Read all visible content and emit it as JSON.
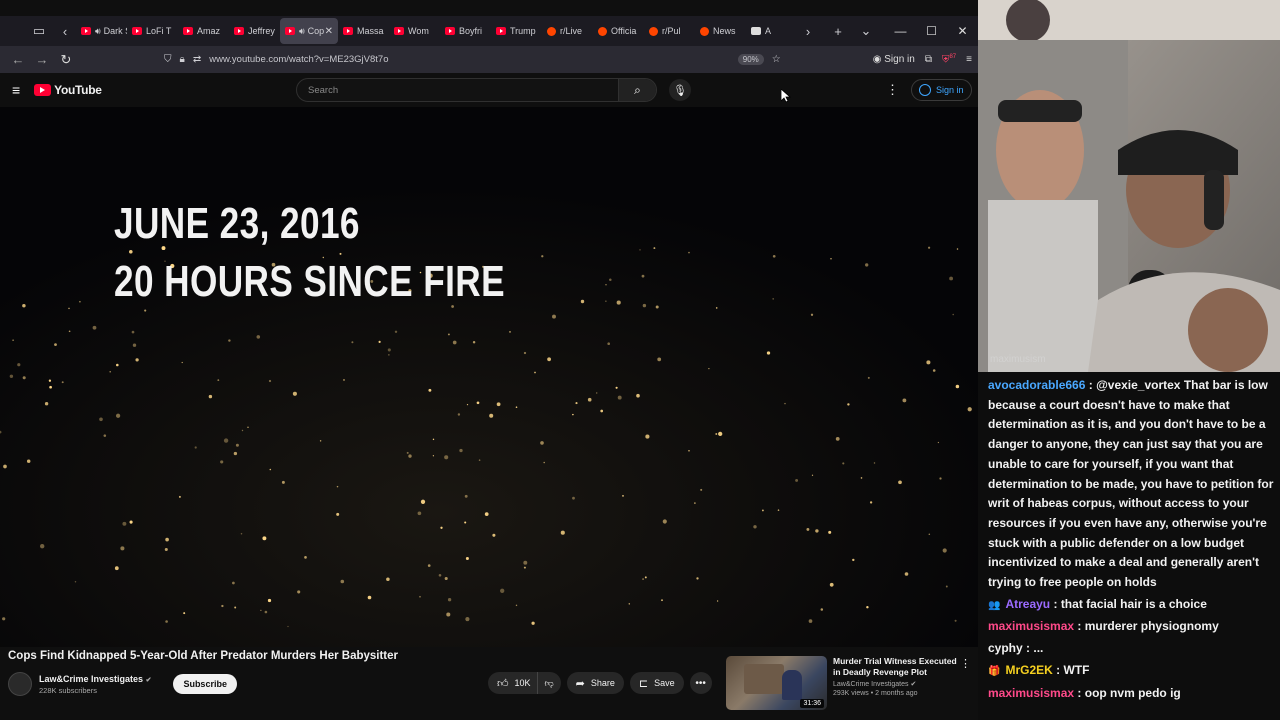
{
  "browser": {
    "tabs": [
      {
        "label": "Dark S",
        "type": "yt",
        "audio": true
      },
      {
        "label": "LoFi T",
        "type": "yt"
      },
      {
        "label": "Amaz",
        "type": "yt"
      },
      {
        "label": "Jeffrey",
        "type": "yt"
      },
      {
        "label": "Cop",
        "type": "yt",
        "audio": true,
        "active": true
      },
      {
        "label": "Massa",
        "type": "yt"
      },
      {
        "label": "Wom",
        "type": "yt"
      },
      {
        "label": "Boyfri",
        "type": "yt"
      },
      {
        "label": "Trump",
        "type": "yt"
      },
      {
        "label": "r/Live",
        "type": "rd"
      },
      {
        "label": "Officia",
        "type": "rd"
      },
      {
        "label": "r/Pul",
        "type": "rd"
      },
      {
        "label": "News",
        "type": "rd"
      },
      {
        "label": "A",
        "type": "md"
      }
    ],
    "url": "www.youtube.com/watch?v=ME23GjV8t7o",
    "zoom": "90%",
    "sign_in": "Sign in",
    "ext_badge": "87"
  },
  "youtube": {
    "logo_text": "YouTube",
    "search_placeholder": "Search",
    "sign_in": "Sign in"
  },
  "video": {
    "overlay_line1": "JUNE 23, 2016",
    "overlay_line2": "20 HOURS SINCE FIRE",
    "title": "Cops Find Kidnapped 5-Year-Old After Predator Murders Her Babysitter",
    "channel": "Law&Crime Investigates",
    "verified": "✔",
    "subscribers": "228K subscribers",
    "subscribe_label": "Subscribe",
    "likes": "10K",
    "share_label": "Share",
    "save_label": "Save"
  },
  "recommendation": {
    "title": "Murder Trial Witness Executed in Deadly Revenge Plot",
    "channel": "Law&Crime Investigates",
    "meta": "293K views • 2 months ago",
    "duration": "31:36"
  },
  "webcam": {
    "label": "maximusism"
  },
  "chat": [
    {
      "user": "avocadorable666",
      "color": "#4aa8ff",
      "text": "@vexie_vortex That bar is low because a court doesn't have to make that determination as it is, and you don't have to be a danger to anyone, they can just say that you are unable to care for yourself, if you want that determination to be made, you have to petition for writ of habeas corpus, without access to your resources if you even have any, otherwise you're stuck with a public defender on a low budget incentivized to make a deal and generally aren't trying to free people on holds"
    },
    {
      "user": "Atreayu",
      "color": "#9b6bff",
      "icon": "👥",
      "text": "that facial hair is a choice"
    },
    {
      "user": "maximusismax",
      "color": "#ff4a8a",
      "text": "murderer physiognomy"
    },
    {
      "user": "cyphy",
      "color": "#f2f2f2",
      "text": "..."
    },
    {
      "user": "MrG2EK",
      "color": "#f5d020",
      "icon": "🎁",
      "text": "WTF"
    },
    {
      "user": "maximusismax",
      "color": "#ff4a8a",
      "text": "oop nvm pedo ig"
    }
  ]
}
